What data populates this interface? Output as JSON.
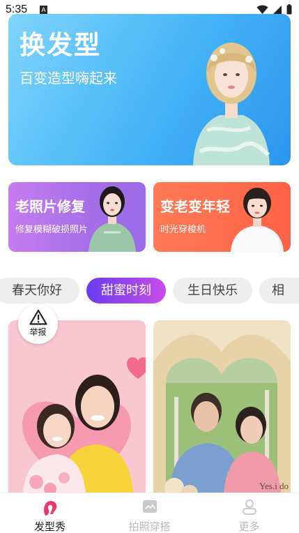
{
  "status_bar": {
    "time": "5:35",
    "notif_letter": "A"
  },
  "hero": {
    "title": "换发型",
    "subtitle": "百变造型嗨起来"
  },
  "feature_cards": [
    {
      "title": "老照片修复",
      "subtitle": "修复模糊破损照片"
    },
    {
      "title": "变老变年轻",
      "subtitle": "时光穿梭机"
    }
  ],
  "tabs": [
    {
      "label": "春天你好",
      "active": false
    },
    {
      "label": "甜蜜时刻",
      "active": true
    },
    {
      "label": "生日快乐",
      "active": false
    },
    {
      "label": "相",
      "active": false
    }
  ],
  "report": {
    "label": "举报"
  },
  "photos": {
    "right_watermark": "Yes.i do"
  },
  "bottom_nav": [
    {
      "label": "发型秀",
      "icon": "hairstyle-icon",
      "active": true
    },
    {
      "label": "拍照穿搭",
      "icon": "photo-outfit-icon",
      "active": false
    },
    {
      "label": "更多",
      "icon": "person-icon",
      "active": false
    }
  ],
  "colors": {
    "hero_blue": "#45b4f7",
    "card_purple": "#a46ee8",
    "card_orange": "#ff6a4c",
    "tab_active_start": "#6a3cf0",
    "tab_active_end": "#c94ce8",
    "nav_active": "#f0356b"
  }
}
